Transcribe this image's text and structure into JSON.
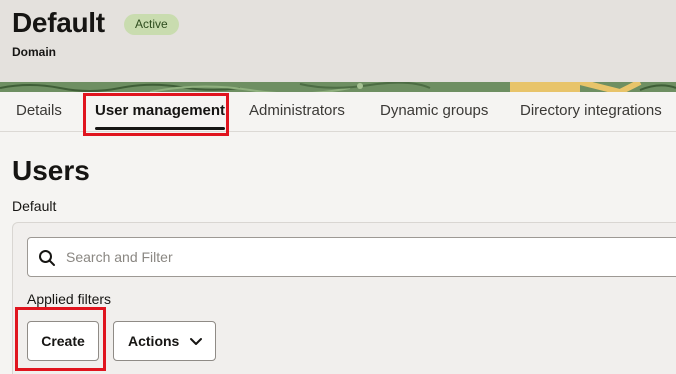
{
  "header": {
    "title": "Default",
    "status": "Active",
    "subtitle": "Domain"
  },
  "tabs": [
    {
      "label": "Details",
      "active": false
    },
    {
      "label": "User management",
      "active": true
    },
    {
      "label": "Administrators",
      "active": false
    },
    {
      "label": "Dynamic groups",
      "active": false
    },
    {
      "label": "Directory integrations",
      "active": false
    }
  ],
  "main": {
    "title": "Users",
    "subtitle": "Default",
    "search": {
      "placeholder": "Search and Filter",
      "value": ""
    },
    "applied_filters_label": "Applied filters",
    "create_label": "Create",
    "actions_label": "Actions"
  },
  "colors": {
    "status_badge_bg": "#c9dcaf",
    "highlight": "#e0141e"
  },
  "icons": {
    "search": "search-icon",
    "actions_dropdown": "chevron-down-icon"
  }
}
